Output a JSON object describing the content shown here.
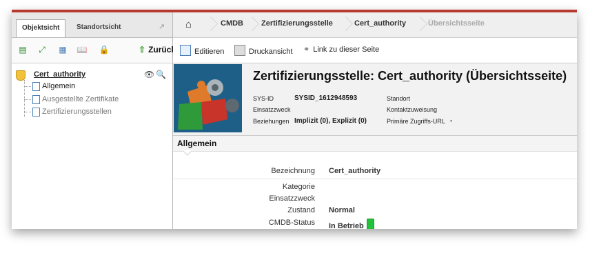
{
  "left_panel": {
    "tabs": [
      {
        "label": "Objektsicht"
      },
      {
        "label": "Standortsicht"
      }
    ],
    "toolbar": {
      "icons": [
        "tree-icon",
        "expand-icon",
        "list-icon",
        "book-icon",
        "lock-icon"
      ],
      "back_label": "Zurück"
    },
    "tree": {
      "root_label": "Cert_authority",
      "children": [
        {
          "label": "Allgemein",
          "state": "active"
        },
        {
          "label": "Ausgestellte Zertifikate",
          "state": "muted"
        },
        {
          "label": "Zertifizierungsstellen",
          "state": "muted"
        }
      ]
    }
  },
  "breadcrumb": {
    "home_icon": "home-icon",
    "items": [
      "CMDB",
      "Zertifizierungsstelle",
      "Cert_authority",
      "Übersichtsseite"
    ]
  },
  "right_toolbar": {
    "edit": "Editieren",
    "print": "Druckansicht",
    "link": "Link zu dieser Seite"
  },
  "object_header": {
    "title": "Zertifizierungsstelle: Cert_authority (Übersichtsseite)",
    "sysid_label": "SYS-ID",
    "sysid_value": "SYSID_1612948593",
    "einsatzzweck_label": "Einsatzzweck",
    "beziehungen_label": "Beziehungen",
    "beziehungen_value": "Implizit (0), Explizit (0)",
    "standort_label": "Standort",
    "kontakt_label": "Kontaktzuweisung",
    "zugriff_label": "Primäre Zugriffs-URL",
    "zugriff_value": "-"
  },
  "section_general": {
    "title": "Allgemein",
    "fields": [
      {
        "label": "Bezeichnung",
        "value": "Cert_authority"
      },
      {
        "label": "Kategorie",
        "value": ""
      },
      {
        "label": "Einsatzzweck",
        "value": ""
      },
      {
        "label": "Zustand",
        "value": "Normal"
      },
      {
        "label": "CMDB-Status",
        "value": "In Betrieb"
      }
    ],
    "status_color": "#23c23a"
  },
  "colors": {
    "accent_bar": "#b8392f",
    "puzzle_bg": "#1d5f87"
  }
}
